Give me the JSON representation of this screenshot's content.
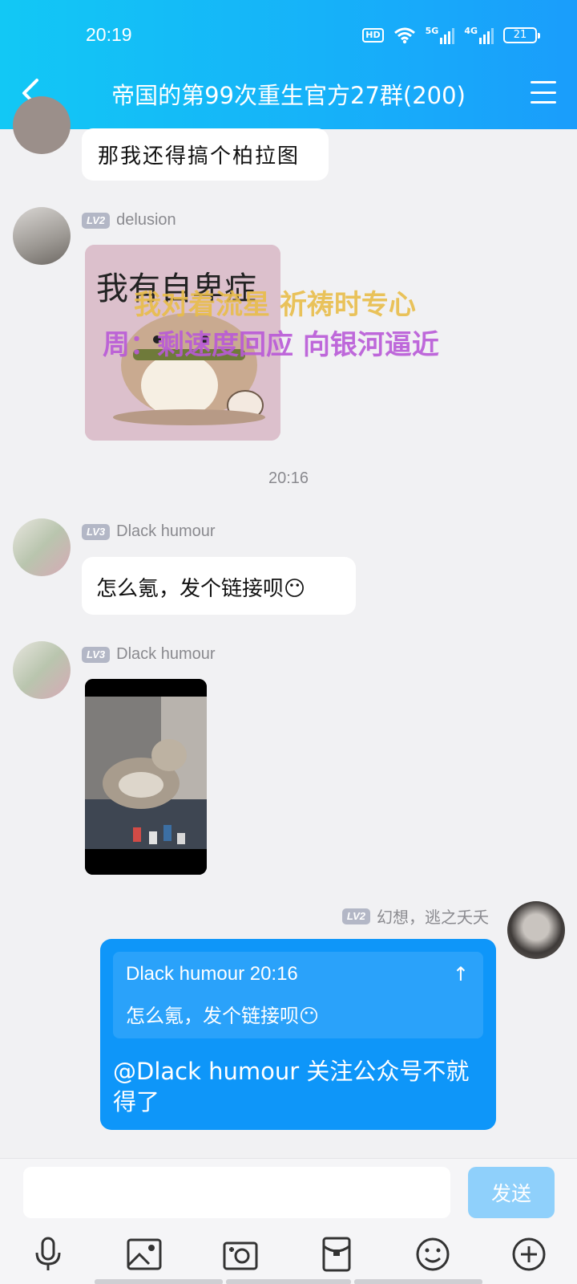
{
  "status_bar": {
    "time": "20:19",
    "hd_label": "HD",
    "net1": "5G",
    "net2": "4G",
    "battery": "21"
  },
  "header": {
    "title": "帝国的第99次重生官方27群(200)"
  },
  "messages": [
    {
      "text": "那我还得搞个柏拉图"
    },
    {
      "level": "LV2",
      "sender": "delusion",
      "sticker_text": "我有自卑症"
    },
    {
      "time": "20:16"
    },
    {
      "level": "LV3",
      "sender": "Dlack humour",
      "text": "怎么氪，发个链接呗😶"
    },
    {
      "level": "LV3",
      "sender": "Dlack humour"
    },
    {
      "level": "LV2",
      "sender": "幻想，逃之夭夭",
      "quote_header": "Dlack humour 20:16",
      "quote_up": "↑",
      "quote_text": "怎么氪，发个链接呗😶",
      "text": "@Dlack humour 关注公众号不就得了"
    }
  ],
  "overlay": {
    "line1": "我对着流星 祈祷时专心",
    "line2": "周：剩速度回应 向银河逼近"
  },
  "input": {
    "placeholder": "",
    "send_label": "发送"
  },
  "toolbar_icons": [
    "microphone-icon",
    "image-icon",
    "camera-icon",
    "red-packet-icon",
    "emoji-icon",
    "plus-icon"
  ],
  "colors": {
    "header_start": "#12c8f5",
    "header_end": "#1a9dfb",
    "my_bubble": "#0e96f9",
    "send_disabled": "#8fd0fb",
    "background": "#f1f1f3"
  }
}
